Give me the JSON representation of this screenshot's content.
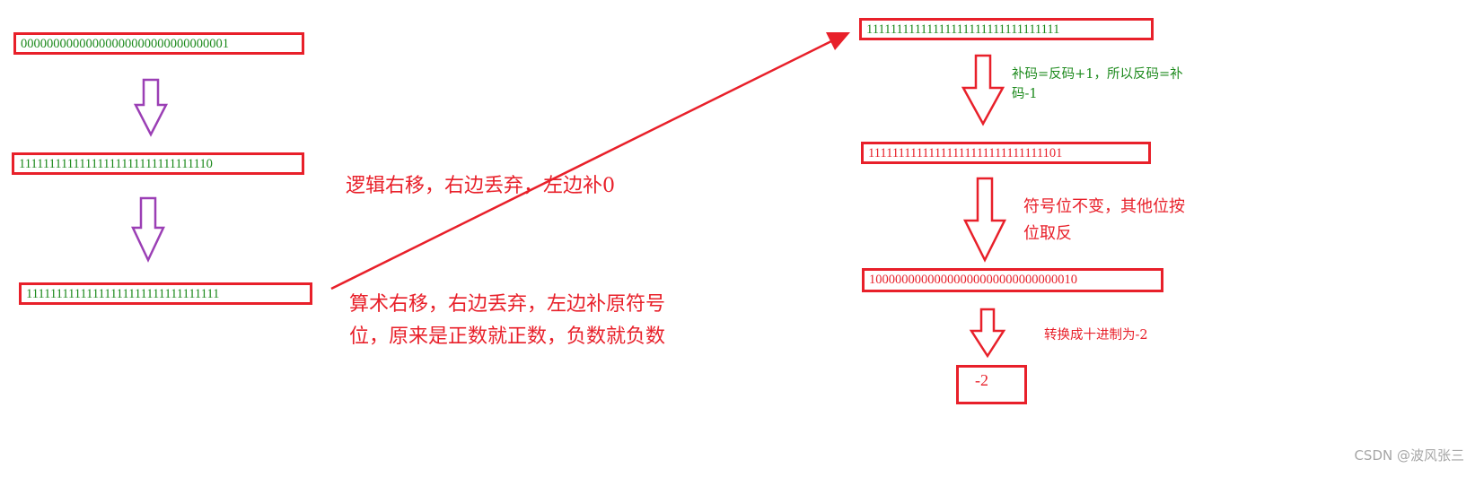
{
  "left_column": {
    "step1_bits": "00000000000000000000000000000001",
    "step2_bits": "11111111111111111111111111111110",
    "step3_bits": "11111111111111111111111111111111"
  },
  "middle_notes": {
    "logical_shift": "逻辑右移，右边丢弃，左边补0",
    "arith_shift_line1": "算术右移，右边丢弃，左边补原符号",
    "arith_shift_line2": "位，原来是正数就正数，负数就负数"
  },
  "right_column": {
    "r1_bits": "11111111111111111111111111111111",
    "note1_line1": "补码=反码+1，所以反码=补",
    "note1_line2": "码-1",
    "r2_bits": "11111111111111111111111111111101",
    "note2_line1": "符号位不变，其他位按",
    "note2_line2": "位取反",
    "r3_bits": "10000000000000000000000000000010",
    "note3": "转换成十进制为-2",
    "result": "-2"
  },
  "watermark": "CSDN @波风张三",
  "colors": {
    "box_border": "#e8202a",
    "green_text": "#1c8a1c",
    "red_text": "#e8202a",
    "purple_arrow": "#9b3fb5",
    "red_arrow": "#e8202a"
  }
}
